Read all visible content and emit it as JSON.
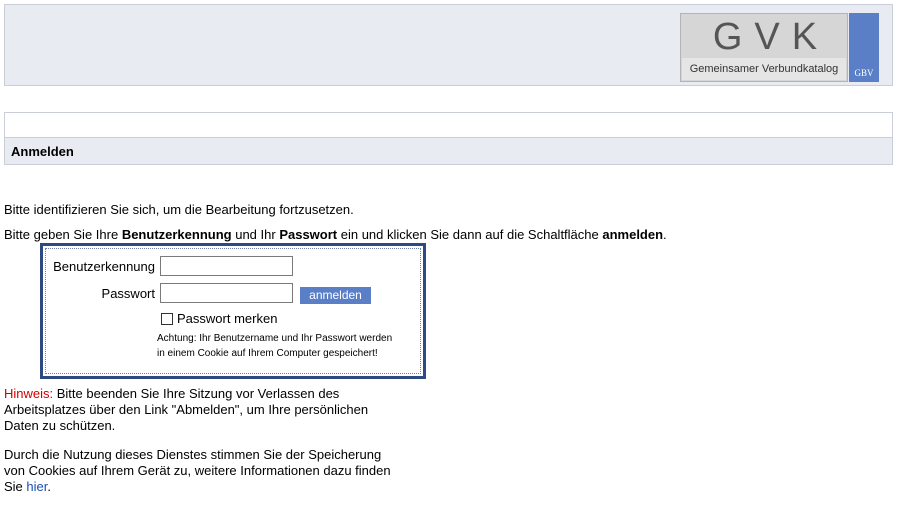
{
  "logo": {
    "title": "GVK",
    "subtitle": "Gemeinsamer Verbundkatalog",
    "badge": "GBV"
  },
  "page": {
    "title": "Anmelden"
  },
  "intro": {
    "line1": "Bitte identifizieren Sie sich, um die Bearbeitung fortzusetzen.",
    "line2_part1": "Bitte geben Sie Ihre ",
    "line2_bold1": "Benutzerkennung",
    "line2_part2": " und Ihr ",
    "line2_bold2": "Passwort",
    "line2_part3": " ein und klicken Sie dann auf die Schaltfläche ",
    "line2_bold3": "anmelden",
    "line2_part4": "."
  },
  "form": {
    "username_label": "Benutzerkennung",
    "username_value": "",
    "password_label": "Passwort",
    "password_value": "",
    "login_button": "anmelden",
    "remember_label": "Passwort merken",
    "remember_checked": false,
    "warning": "Achtung: Ihr Benutzername und Ihr Passwort werden in einem Cookie auf Ihrem Computer gespeichert!"
  },
  "notice": {
    "label": "Hinweis:",
    "text": " Bitte beenden Sie Ihre Sitzung vor Verlassen des Arbeitsplatzes über den Link \"Abmelden\", um Ihre persönlichen Daten zu schützen."
  },
  "cookie": {
    "text": "Durch die Nutzung dieses Dienstes stimmen Sie der Speicherung von Cookies auf Ihrem Gerät zu, weitere Informationen dazu finden Sie ",
    "link": "hier",
    "end": "."
  },
  "colors": {
    "accent": "#5a7fc7",
    "form_border": "#2d4a82",
    "header_bg": "#e8ebf1",
    "notice_red": "#d00000"
  }
}
